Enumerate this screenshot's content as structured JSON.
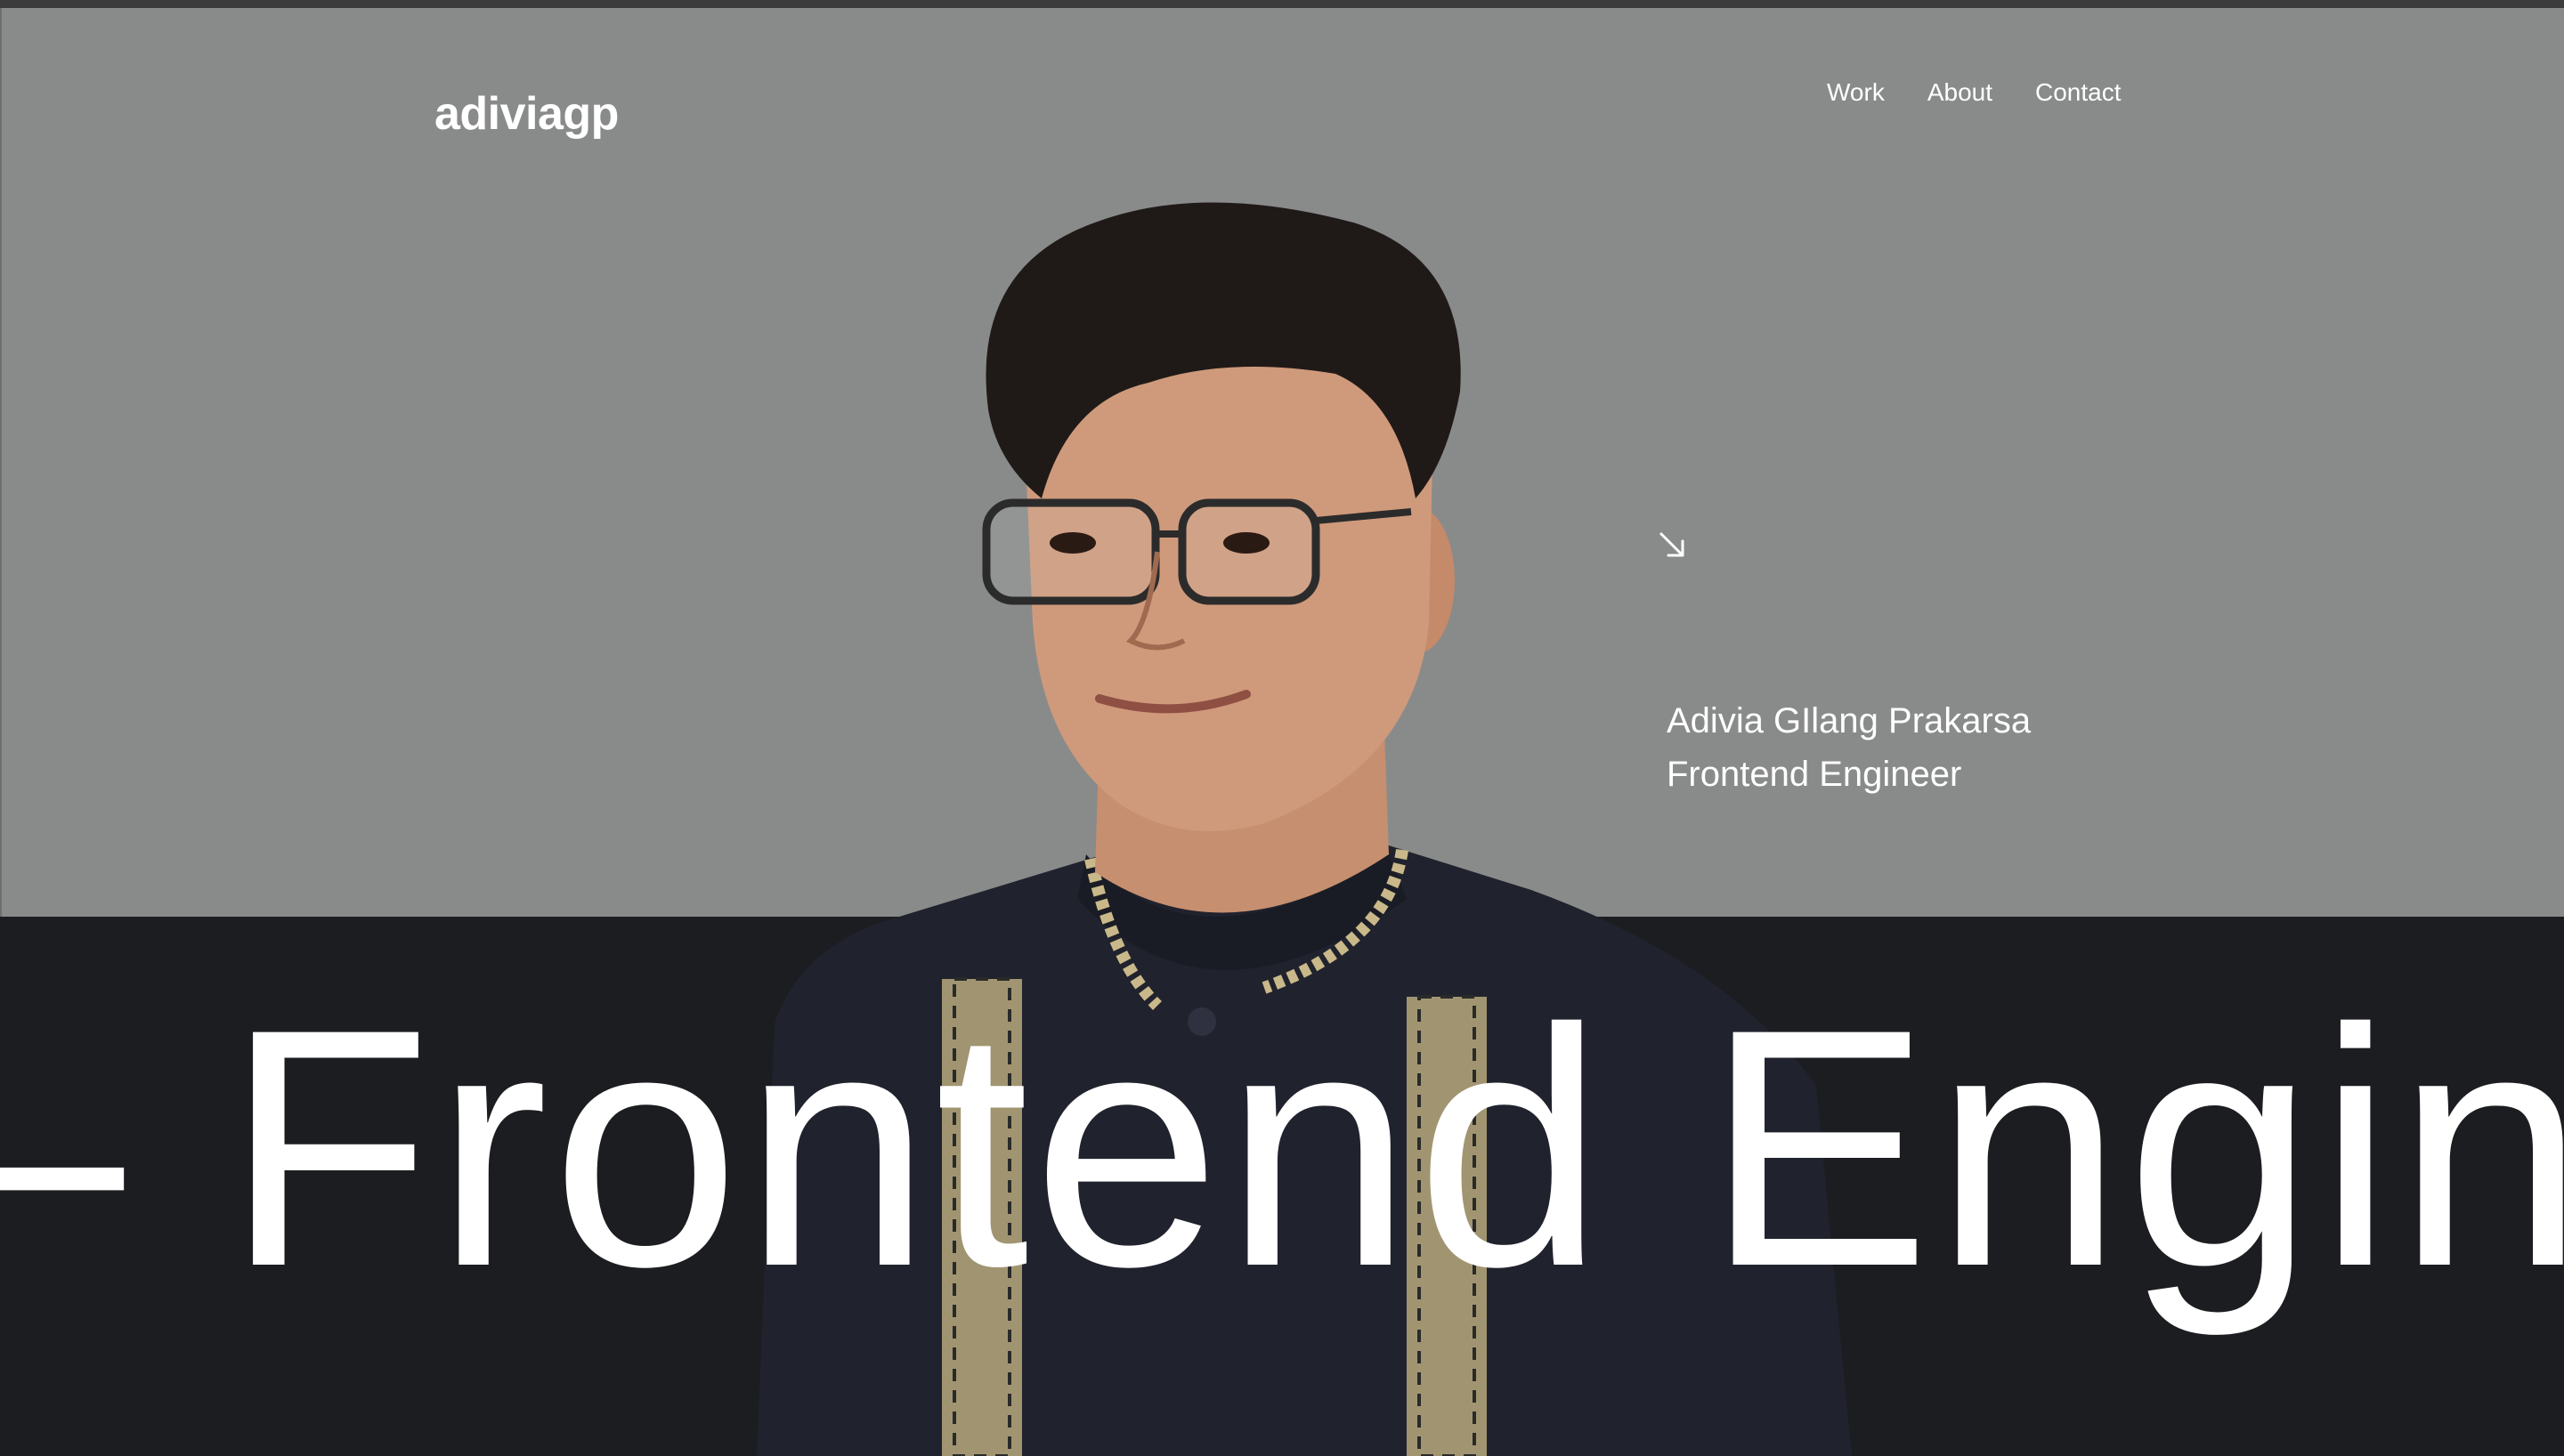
{
  "brand": {
    "logo": "adiviagp"
  },
  "nav": {
    "items": [
      "Work",
      "About",
      "Contact"
    ]
  },
  "hero": {
    "arrow_icon": "arrow-down-right-icon",
    "name": "Adivia GIlang Prakarsa",
    "role": "Frontend Engineer",
    "marquee": "– Frontend Engin"
  },
  "colors": {
    "top_background": "#898b8a",
    "bottom_background": "#1c1d21",
    "text": "#ffffff",
    "embroidery": "#c9b88a"
  }
}
